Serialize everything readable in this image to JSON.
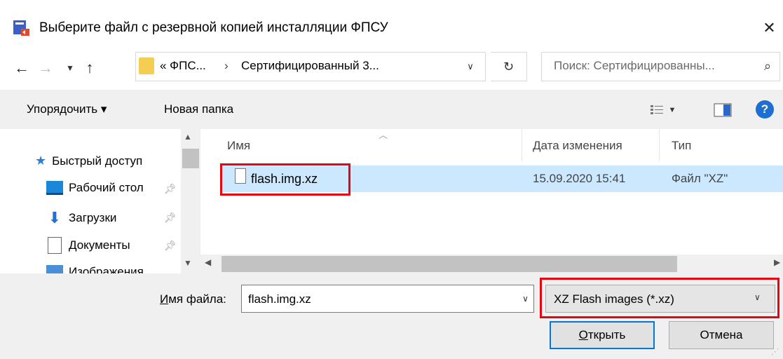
{
  "window": {
    "title": "Выберите файл с резервной копией инсталляции ФПСУ",
    "close_symbol": "✕"
  },
  "nav": {
    "back_icon": "←",
    "forward_icon": "→",
    "recent_icon": "⌄",
    "up_icon": "↑",
    "breadcrumb": [
      "« ФПС...",
      "Сертифицированный 3..."
    ],
    "breadcrumb_sep": "›",
    "refresh_icon": "↻",
    "search_placeholder": "Поиск: Сертифицированны..."
  },
  "toolbar": {
    "organize_label": "Упорядочить ▾",
    "new_folder_label": "Новая папка",
    "help_label": "?"
  },
  "sidebar": {
    "items": [
      {
        "label": "Быстрый доступ",
        "icon": "star-icon",
        "pinned": false
      },
      {
        "label": "Рабочий стол",
        "icon": "desktop-icon",
        "pinned": true
      },
      {
        "label": "Загрузки",
        "icon": "download-icon",
        "pinned": true
      },
      {
        "label": "Документы",
        "icon": "documents-icon",
        "pinned": true
      },
      {
        "label": "Изображения",
        "icon": "pictures-icon",
        "pinned": true
      }
    ]
  },
  "filelist": {
    "columns": [
      "Имя",
      "Дата изменения",
      "Тип"
    ],
    "rows": [
      {
        "name": "flash.img.xz",
        "date": "15.09.2020 15:41",
        "type": "Файл \"XZ\"",
        "selected": true
      }
    ]
  },
  "footer": {
    "filename_label_first": "И",
    "filename_label_rest": "мя файла:",
    "filename_value": "flash.img.xz",
    "filter_value": "XZ Flash images (*.xz)",
    "open_label_first": "О",
    "open_label_rest": "ткрыть",
    "cancel_label": "Отмена"
  },
  "colors": {
    "highlight_border": "#e30613",
    "selection_bg": "#cce8ff",
    "focus_border": "#0078d7",
    "help_blue": "#1f6fd1"
  }
}
